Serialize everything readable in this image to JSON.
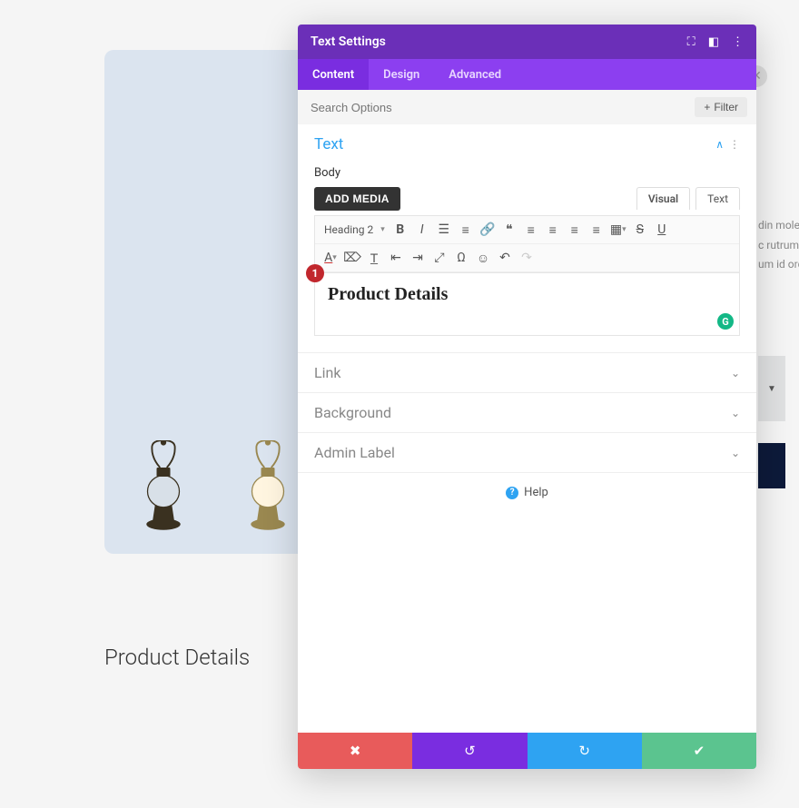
{
  "bg": {
    "heading": "Product Details",
    "side_text": [
      "din moles",
      "c rutrum e",
      "um id orci"
    ],
    "caret": "▼"
  },
  "panel": {
    "title": "Text Settings",
    "tabs": [
      "Content",
      "Design",
      "Advanced"
    ],
    "active_tab": 0,
    "search_placeholder": "Search Options",
    "filter_label": "Filter"
  },
  "text_section": {
    "title": "Text",
    "body_label": "Body",
    "add_media": "ADD MEDIA",
    "editor_tabs": {
      "visual": "Visual",
      "text": "Text"
    },
    "format_select": "Heading 2",
    "content": "Product Details",
    "badge": "1"
  },
  "collapsed": {
    "link": "Link",
    "background": "Background",
    "admin_label": "Admin Label"
  },
  "help": {
    "label": "Help"
  }
}
